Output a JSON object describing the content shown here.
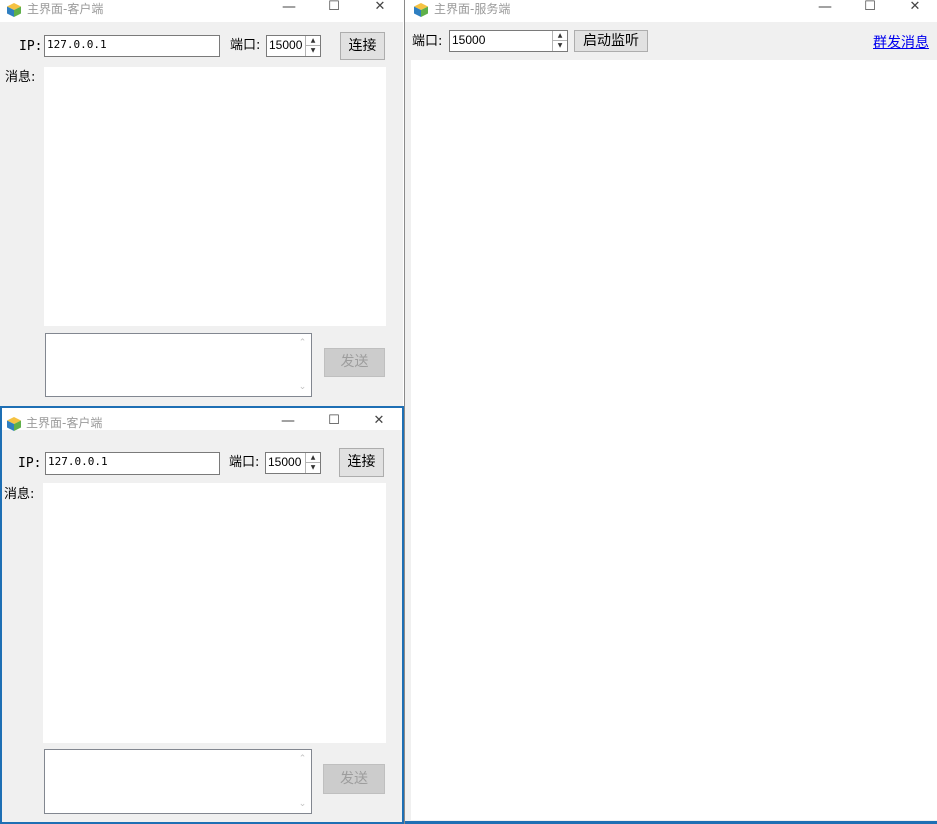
{
  "client1": {
    "title": "主界面-客户端",
    "ip_label": "IP:",
    "ip_value": "127.0.0.1",
    "port_label": "端口:",
    "port_value": "15000",
    "connect_label": "连接",
    "msg_label": "消息:",
    "send_label": "发送"
  },
  "client2": {
    "title": "主界面-客户端",
    "ip_label": "IP:",
    "ip_value": "127.0.0.1",
    "port_label": "端口:",
    "port_value": "15000",
    "connect_label": "连接",
    "msg_label": "消息:",
    "send_label": "发送"
  },
  "server": {
    "title": "主界面-服务端",
    "port_label": "端口:",
    "port_value": "15000",
    "listen_label": "启动监听",
    "broadcast_label": "群发消息"
  },
  "window_controls": {
    "minimize": "—",
    "maximize": "☐",
    "close": "✕"
  },
  "colors": {
    "active_border": "#1e6fb4",
    "link": "#0000ee",
    "disabled_button": "#cccccc"
  }
}
